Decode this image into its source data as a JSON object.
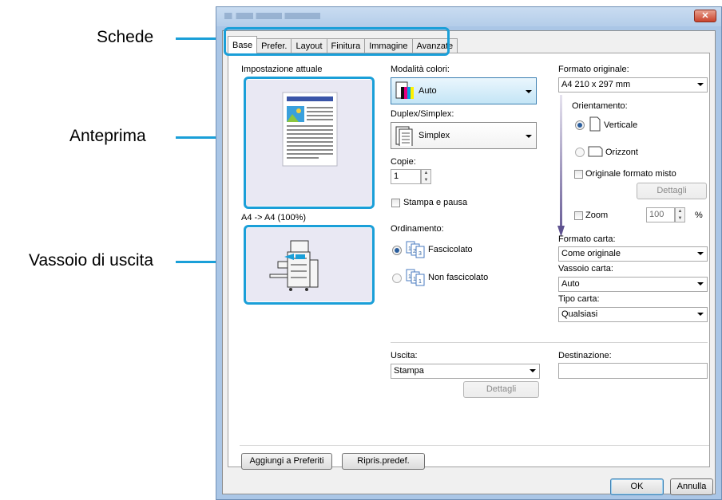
{
  "callouts": {
    "tabs": "Schede",
    "preview": "Anteprima",
    "output_tray": "Vassoio di uscita"
  },
  "tabs": [
    "Base",
    "Prefer.",
    "Layout",
    "Finitura",
    "Immagine",
    "Avanzate"
  ],
  "current_settings": {
    "label": "Impostazione attuale",
    "scale_text": "A4 -> A4 (100%)"
  },
  "color_mode": {
    "label": "Modalità colori:",
    "value": "Auto"
  },
  "duplex": {
    "label": "Duplex/Simplex:",
    "value": "Simplex"
  },
  "copies": {
    "label": "Copie:",
    "value": "1"
  },
  "print_pause": {
    "label": "Stampa e pausa",
    "checked": false
  },
  "sorting": {
    "label": "Ordinamento:",
    "options": [
      "Fascicolato",
      "Non fascicolato"
    ],
    "selected": "Fascicolato"
  },
  "original_size": {
    "label": "Formato originale:",
    "value": "A4 210 x 297 mm"
  },
  "orientation": {
    "label": "Orientamento:",
    "options": [
      "Verticale",
      "Orizzont"
    ],
    "selected": "Verticale"
  },
  "mixed_size": {
    "label": "Originale formato misto",
    "checked": false,
    "details_button": "Dettagli"
  },
  "zoom": {
    "label": "Zoom",
    "value": "100",
    "unit": "%",
    "checked": false
  },
  "paper_size": {
    "label": "Formato carta:",
    "value": "Come originale"
  },
  "paper_tray": {
    "label": "Vassoio carta:",
    "value": "Auto"
  },
  "paper_type": {
    "label": "Tipo carta:",
    "value": "Qualsiasi"
  },
  "output": {
    "label": "Uscita:",
    "value": "Stampa",
    "details_button": "Dettagli"
  },
  "destination": {
    "label": "Destinazione:",
    "value": ""
  },
  "footer_buttons": {
    "add_favorites": "Aggiungi a Preferiti",
    "restore_defaults": "Ripris.predef."
  },
  "dialog_buttons": {
    "ok": "OK",
    "cancel": "Annulla"
  },
  "colors": {
    "callout_accent": "#1a9fd8",
    "preview_bg": "#e9e8f3",
    "title_bar": "#b4cde9"
  }
}
